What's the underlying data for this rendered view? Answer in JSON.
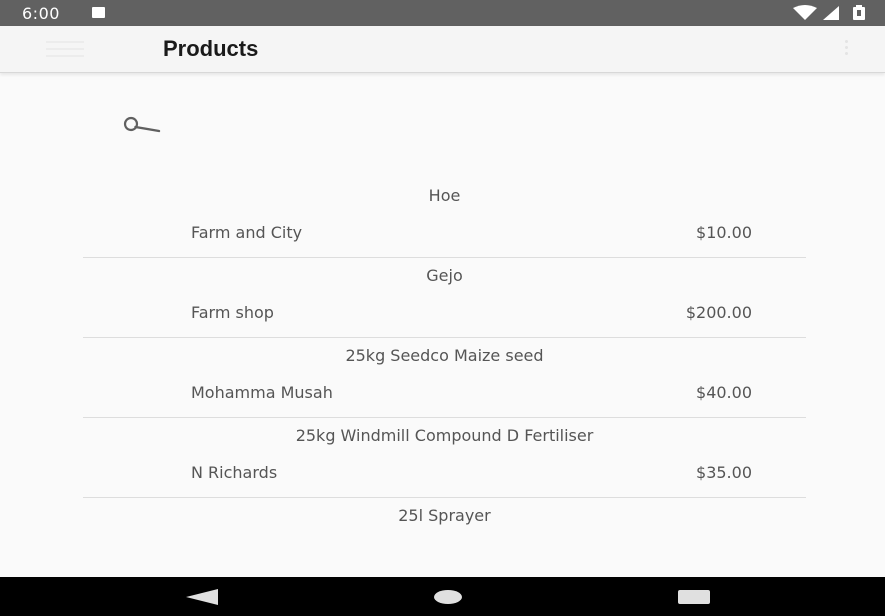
{
  "status_bar": {
    "time": "6:00",
    "icons": [
      "sd-card-icon",
      "wifi-icon",
      "signal-icon",
      "battery-icon"
    ]
  },
  "app_bar": {
    "menu_icon": "menu-icon",
    "title": "Products",
    "overflow_icon": "more-vert-icon"
  },
  "search": {
    "icon": "search-icon"
  },
  "products": [
    {
      "name": "Hoe",
      "seller": "Farm and City",
      "price": "$10.00"
    },
    {
      "name": "Gejo",
      "seller": "Farm shop",
      "price": "$200.00"
    },
    {
      "name": "25kg Seedco Maize seed",
      "seller": "Mohamma Musah",
      "price": "$40.00"
    },
    {
      "name": "25kg Windmill Compound D Fertiliser",
      "seller": "N Richards",
      "price": "$35.00"
    },
    {
      "name": "25l Sprayer",
      "seller": "",
      "price": ""
    }
  ],
  "nav_bar": {
    "icons": [
      "back-icon",
      "home-icon",
      "recents-icon"
    ]
  },
  "colors": {
    "status_bar": "#616161",
    "app_bar": "#f5f5f5",
    "background": "#fafafa",
    "text": "#555555",
    "nav_bar": "#000000"
  }
}
